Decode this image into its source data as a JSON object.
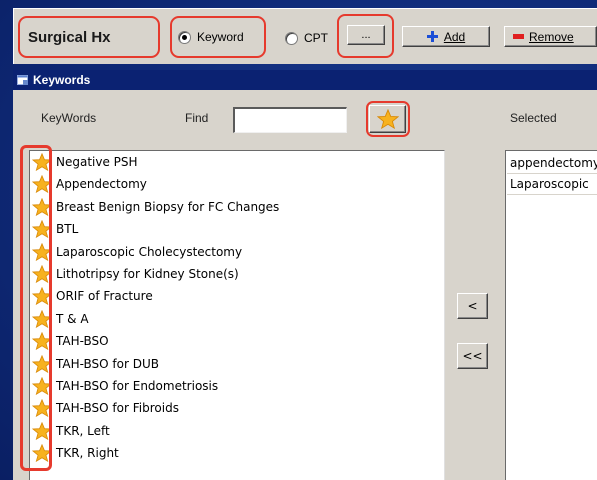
{
  "toolbar": {
    "title": "Surgical Hx",
    "keyword_radio_label": "Keyword",
    "cpt_radio_label": "CPT",
    "ellipsis_label": "...",
    "add_label": "Add",
    "remove_label": "Remove"
  },
  "panel": {
    "title": "Keywords",
    "keywords_label": "KeyWords",
    "find_label": "Find",
    "find_value": "",
    "selected_label": "Selected",
    "move_left_label": "<",
    "move_all_left_label": "<<"
  },
  "keywords": [
    {
      "label": " Negative PSH"
    },
    {
      "label": "Appendectomy"
    },
    {
      "label": "Breast Benign Biopsy for FC Changes"
    },
    {
      "label": "BTL"
    },
    {
      "label": "Laparoscopic Cholecystectomy"
    },
    {
      "label": "Lithotripsy for Kidney Stone(s)"
    },
    {
      "label": "ORIF of Fracture"
    },
    {
      "label": "T & A"
    },
    {
      "label": "TAH-BSO"
    },
    {
      "label": "TAH-BSO for DUB"
    },
    {
      "label": "TAH-BSO for Endometriosis"
    },
    {
      "label": "TAH-BSO for Fibroids"
    },
    {
      "label": "TKR, Left"
    },
    {
      "label": "TKR, Right"
    }
  ],
  "selected": [
    {
      "label": "appendectomy"
    },
    {
      "label": "Laparoscopic"
    }
  ],
  "colors": {
    "highlight_outline": "#e63a2d",
    "panel_header": "#0b2272",
    "background": "#0f2a78"
  }
}
